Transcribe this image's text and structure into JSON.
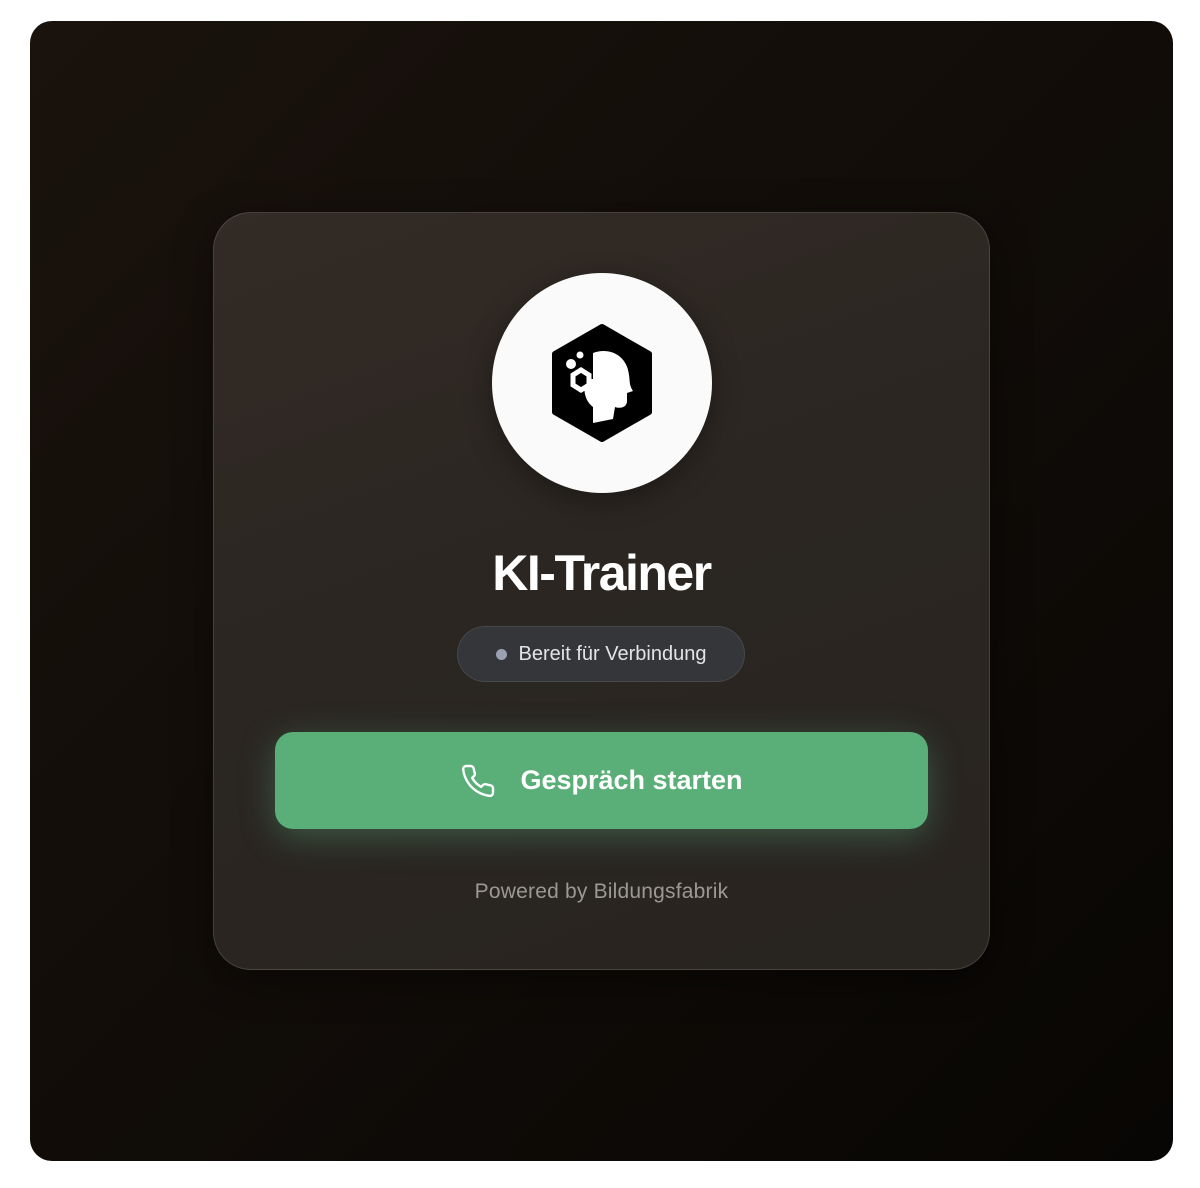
{
  "app": {
    "title": "KI-Trainer",
    "logo_icon": "ai-head-hexagon-icon"
  },
  "status": {
    "text": "Bereit für Verbindung",
    "dot_color": "#9aa1b3"
  },
  "call_button": {
    "label": "Gespräch starten",
    "icon": "phone-icon",
    "color": "#5aae78"
  },
  "footer": {
    "text": "Powered by Bildungsfabrik"
  }
}
